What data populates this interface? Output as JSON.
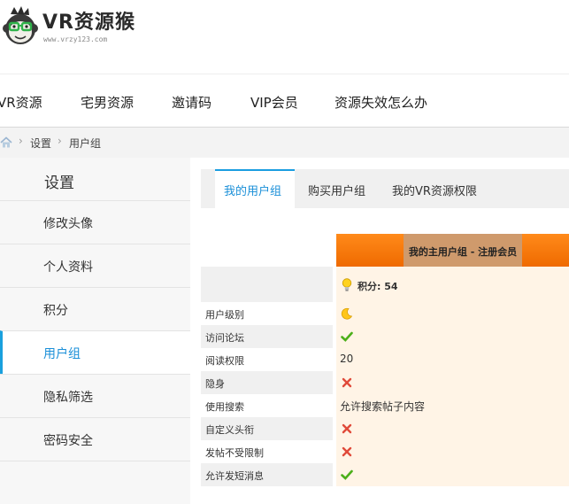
{
  "site": {
    "title": "VR资源猴",
    "url": "www.vrzy123.com"
  },
  "nav": {
    "items": [
      "VR资源",
      "宅男资源",
      "邀请码",
      "VIP会员",
      "资源失效怎么办"
    ]
  },
  "breadcrumb": {
    "home_icon": "home-icon",
    "items": [
      "设置",
      "用户组"
    ]
  },
  "sidebar": {
    "title": "设置",
    "items": [
      {
        "label": "修改头像",
        "active": false
      },
      {
        "label": "个人资料",
        "active": false
      },
      {
        "label": "积分",
        "active": false
      },
      {
        "label": "用户组",
        "active": true
      },
      {
        "label": "隐私筛选",
        "active": false
      },
      {
        "label": "密码安全",
        "active": false
      }
    ]
  },
  "tabs": [
    {
      "label": "我的用户组",
      "active": true
    },
    {
      "label": "购买用户组",
      "active": false
    },
    {
      "label": "我的VR资源权限",
      "active": false
    }
  ],
  "group": {
    "header": "我的主用户组 - 注册会员",
    "credit": "积分: 54",
    "rows": [
      {
        "label": "用户级别",
        "value": "",
        "icon": "moon-icon"
      },
      {
        "label": "访问论坛",
        "value": "",
        "icon": "check-icon"
      },
      {
        "label": "阅读权限",
        "value": "20",
        "icon": ""
      },
      {
        "label": "隐身",
        "value": "",
        "icon": "cross-icon"
      },
      {
        "label": "使用搜索",
        "value": "允许搜索帖子内容",
        "icon": ""
      },
      {
        "label": "自定义头衔",
        "value": "",
        "icon": "cross-icon"
      },
      {
        "label": "发帖不受限制",
        "value": "",
        "icon": "cross-icon"
      },
      {
        "label": "允许发短消息",
        "value": "",
        "icon": "check-icon"
      }
    ]
  },
  "colors": {
    "accent": "#1a8fd8",
    "header_orange": "#ff8a1a",
    "row_bg": "#fff4e6",
    "check_green": "#4caf1a",
    "cross_red": "#e04a3a"
  }
}
